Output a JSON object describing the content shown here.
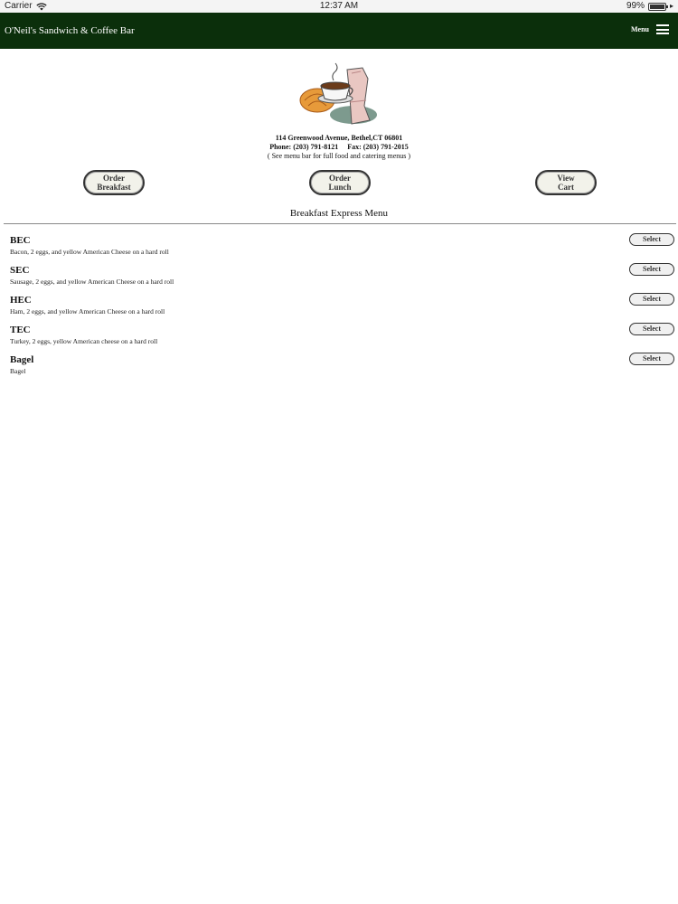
{
  "status_bar": {
    "carrier": "Carrier",
    "time": "12:37 AM",
    "battery": "99%",
    "battery_level": 0.99
  },
  "header": {
    "title": "O'Neil's Sandwich & Coffee Bar",
    "menu_label": "Menu"
  },
  "info": {
    "address": "114 Greenwood Avenue, Bethel,CT 06801",
    "phone": "Phone: (203) 791-8121",
    "fax": "Fax: (203) 791-2015",
    "note": "( See menu bar for full food and catering menus )"
  },
  "actions": {
    "breakfast_line1": "Order",
    "breakfast_line2": "Breakfast",
    "lunch_line1": "Order",
    "lunch_line2": "Lunch",
    "cart_line1": "View",
    "cart_line2": "Cart"
  },
  "section_title": "Breakfast Express Menu",
  "menu_items": [
    {
      "name": "BEC",
      "description": "Bacon, 2 eggs, and yellow American Cheese on a hard roll",
      "button": "Select"
    },
    {
      "name": "SEC",
      "description": "Sausage, 2 eggs, and yellow American Cheese on a hard roll",
      "button": "Select"
    },
    {
      "name": "HEC",
      "description": "Ham, 2 eggs, and yellow American Cheese on a hard roll",
      "button": "Select"
    },
    {
      "name": "TEC",
      "description": "Turkey, 2 eggs, yellow American cheese on a hard roll",
      "button": "Select"
    },
    {
      "name": "Bagel",
      "description": "Bagel",
      "button": "Select"
    }
  ],
  "colors": {
    "header_bg": "#0b2f0b"
  }
}
